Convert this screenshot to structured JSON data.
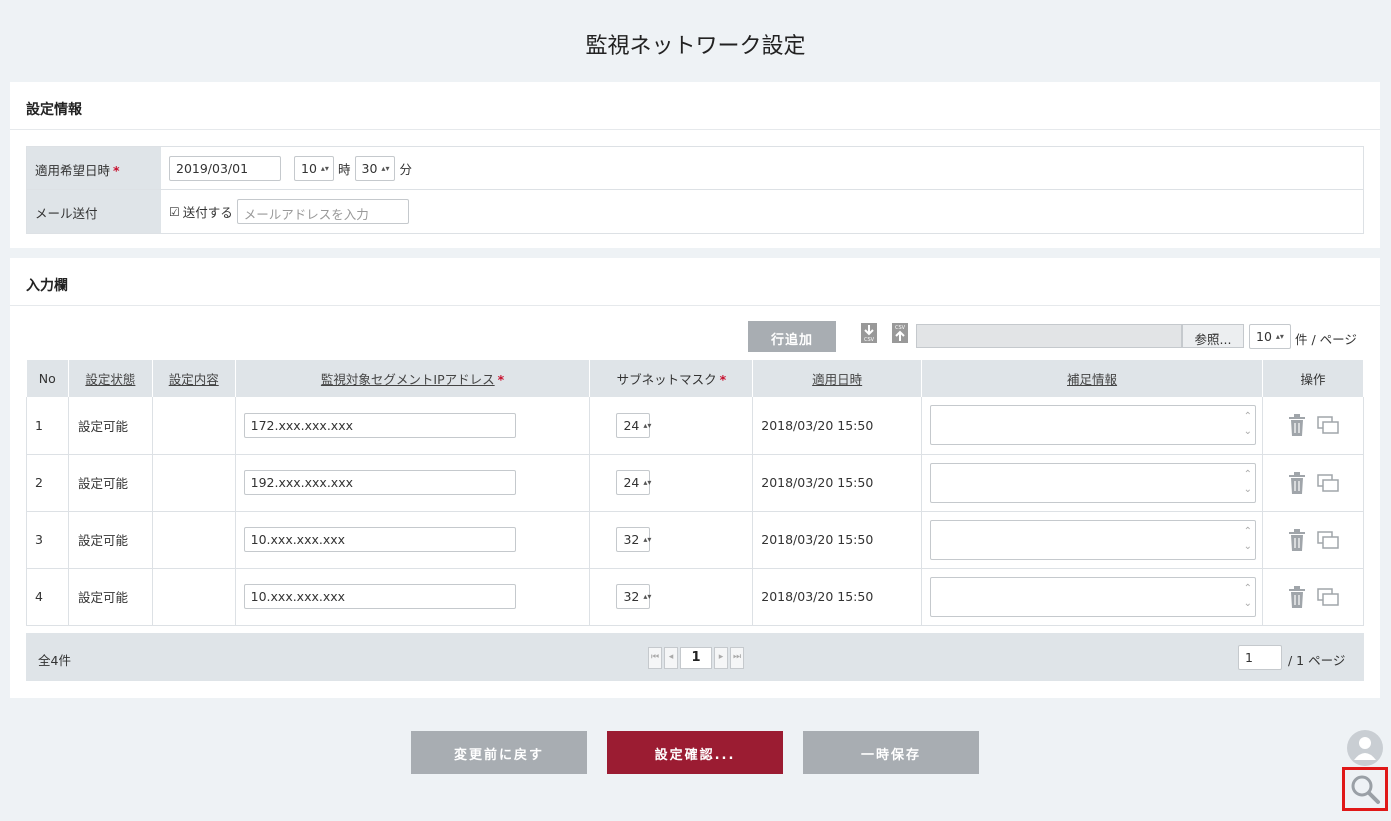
{
  "page": {
    "title": "監視ネットワーク設定"
  },
  "settings": {
    "heading": "設定情報",
    "date_label": "適用希望日時",
    "date_value": "2019/03/01",
    "hour_value": "10",
    "hour_unit": "時",
    "minute_value": "30",
    "minute_unit": "分",
    "mail_label": "メール送付",
    "mail_check_label": "送付する",
    "mail_placeholder": "メールアドレスを入力"
  },
  "input": {
    "heading": "入力欄",
    "add_row_label": "行追加",
    "browse_label": "参照...",
    "per_page_value": "10",
    "per_page_label": "件 / ページ",
    "columns": [
      "No",
      "設定状態",
      "設定内容",
      "監視対象セグメントIPアドレス",
      "サブネットマスク",
      "適用日時",
      "補足情報",
      "操作"
    ],
    "rows": [
      {
        "no": "1",
        "status": "設定可能",
        "ip": "172.xxx.xxx.xxx",
        "mask": "24",
        "date": "2018/03/20 15:50"
      },
      {
        "no": "2",
        "status": "設定可能",
        "ip": "192.xxx.xxx.xxx",
        "mask": "24",
        "date": "2018/03/20 15:50"
      },
      {
        "no": "3",
        "status": "設定可能",
        "ip": "10.xxx.xxx.xxx",
        "mask": "32",
        "date": "2018/03/20 15:50"
      },
      {
        "no": "4",
        "status": "設定可能",
        "ip": "10.xxx.xxx.xxx",
        "mask": "32",
        "date": "2018/03/20 15:50"
      }
    ],
    "total_label": "全4件",
    "current_page": "1",
    "page_input": "1",
    "pages_label": "/ 1 ページ"
  },
  "actions": {
    "revert_label": "変更前に戻す",
    "confirm_label": "設定確認...",
    "save_label": "一時保存"
  },
  "colors": {
    "accent": "#9b1c32",
    "required": "#c8102e",
    "highlight_border": "#e01818"
  }
}
